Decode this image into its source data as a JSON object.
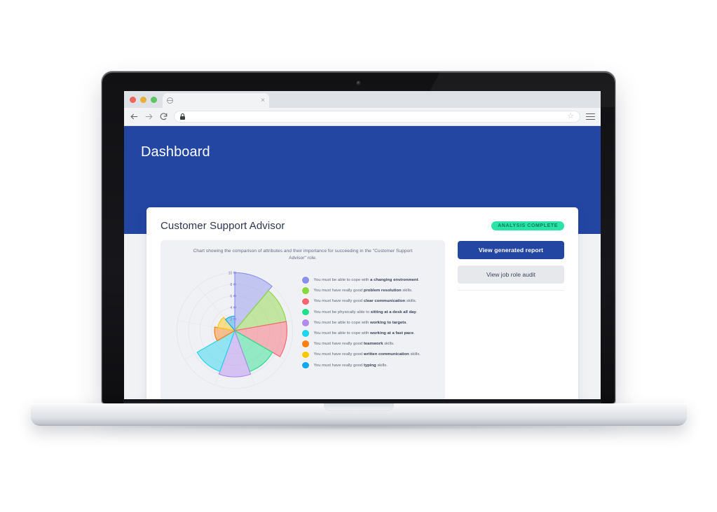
{
  "browser": {
    "tab_title": "",
    "tab_favicon": "globe-icon",
    "tab_close": "×",
    "url": "",
    "url_placeholder": "",
    "back_icon": "back-arrow-icon",
    "forward_icon": "forward-arrow-icon",
    "reload_icon": "reload-icon",
    "lock_icon": "lock-icon",
    "star_icon": "☆",
    "menu_icon": "hamburger-menu-icon"
  },
  "app": {
    "header_title": "Dashboard",
    "header_color": "#2446A3"
  },
  "card": {
    "title": "Customer Support Advisor",
    "badge": "ANALYSIS COMPLETE",
    "badge_color": "#2ae3a6",
    "chart_handle": "resize-handle"
  },
  "actions": {
    "primary_label": "View generated report",
    "secondary_label": "View job role audit"
  },
  "chart_data": {
    "type": "pie",
    "subtype": "polar-area-rose",
    "title": "Chart showing the comparison of attributes and their importance for succeeding in the \"Customer Support Advisor\" role.",
    "rlim": [
      0,
      10
    ],
    "rticks": [
      2,
      4,
      6,
      8,
      10
    ],
    "rtick_labels": [
      "2",
      "4",
      "6",
      "8",
      "10"
    ],
    "grid": true,
    "legend_position": "right",
    "sector_count": 9,
    "sector_span_deg": 40,
    "start_angle_deg": 0,
    "categories": [
      "a changing environment",
      "problem resolution",
      "clear communication",
      "sitting at a desk all day",
      "working to targets",
      "working at a fast pace",
      "teamwork",
      "written communication",
      "typing"
    ],
    "values": [
      10,
      9,
      9,
      7.5,
      8,
      7.5,
      3.5,
      3,
      2.5
    ],
    "colors": [
      "#8b90ee",
      "#89d83f",
      "#f8636f",
      "#1fe08a",
      "#b28bf0",
      "#1ed5ef",
      "#f98012",
      "#fcc60b",
      "#13a7ee"
    ],
    "fill_opacity": 0.45,
    "legend": [
      {
        "color": "#8b90ee",
        "prefix": "You must be able to cope with ",
        "bold": "a changing environment",
        "suffix": "."
      },
      {
        "color": "#89d83f",
        "prefix": "You must have really good ",
        "bold": "problem resolution",
        "suffix": " skills."
      },
      {
        "color": "#f8636f",
        "prefix": "You must have really good ",
        "bold": "clear communication",
        "suffix": " skills."
      },
      {
        "color": "#1fe08a",
        "prefix": "You must be physically able to ",
        "bold": "sitting at a desk all day",
        "suffix": "."
      },
      {
        "color": "#b28bf0",
        "prefix": "You must be able to cope with ",
        "bold": "working to targets",
        "suffix": "."
      },
      {
        "color": "#1ed5ef",
        "prefix": "You must be able to cope with ",
        "bold": "working at a fast pace",
        "suffix": "."
      },
      {
        "color": "#f98012",
        "prefix": "You must have really good ",
        "bold": "teamwork",
        "suffix": " skills."
      },
      {
        "color": "#fcc60b",
        "prefix": "You must have really good ",
        "bold": "written communication",
        "suffix": " skills."
      },
      {
        "color": "#13a7ee",
        "prefix": "You must have really good ",
        "bold": "typing",
        "suffix": " skills."
      }
    ]
  }
}
